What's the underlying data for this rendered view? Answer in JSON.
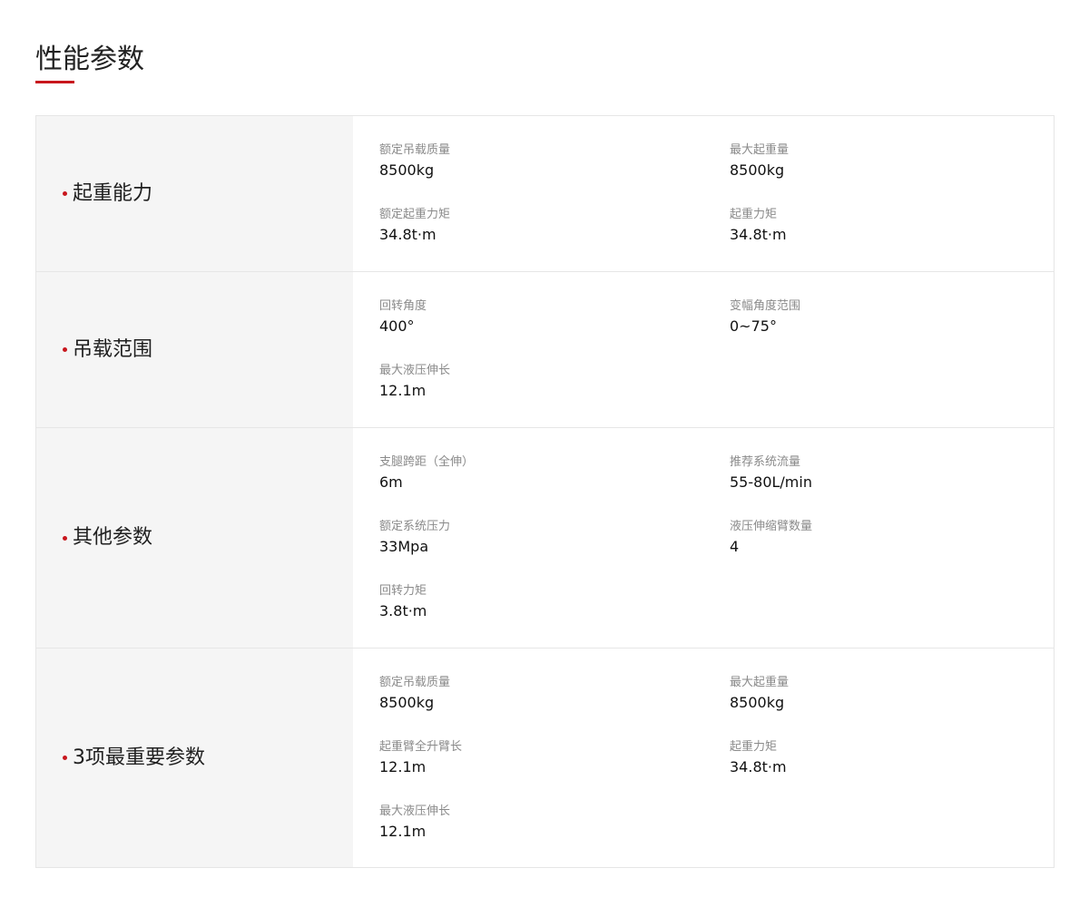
{
  "page": {
    "title": "性能参数",
    "accent_color": "#c8161d"
  },
  "sections": [
    {
      "label": "起重能力",
      "params": [
        {
          "name": "额定吊载质量",
          "value": "8500kg"
        },
        {
          "name": "最大起重量",
          "value": "8500kg"
        },
        {
          "name": "额定起重力矩",
          "value": "34.8t·m"
        },
        {
          "name": "起重力矩",
          "value": "34.8t·m"
        }
      ]
    },
    {
      "label": "吊载范围",
      "params": [
        {
          "name": "回转角度",
          "value": "400°"
        },
        {
          "name": "变幅角度范围",
          "value": "0~75°"
        },
        {
          "name": "最大液压伸长",
          "value": "12.1m"
        }
      ]
    },
    {
      "label": "其他参数",
      "params": [
        {
          "name": "支腿跨距（全伸）",
          "value": "6m"
        },
        {
          "name": "推荐系统流量",
          "value": "55-80L/min"
        },
        {
          "name": "额定系统压力",
          "value": "33Mpa"
        },
        {
          "name": "液压伸缩臂数量",
          "value": "4"
        },
        {
          "name": "回转力矩",
          "value": "3.8t·m"
        }
      ]
    },
    {
      "label": "3项最重要参数",
      "params": [
        {
          "name": "额定吊载质量",
          "value": "8500kg"
        },
        {
          "name": "最大起重量",
          "value": "8500kg"
        },
        {
          "name": "起重臂全升臂长",
          "value": "12.1m"
        },
        {
          "name": "起重力矩",
          "value": "34.8t·m"
        },
        {
          "name": "最大液压伸长",
          "value": "12.1m"
        }
      ]
    }
  ]
}
